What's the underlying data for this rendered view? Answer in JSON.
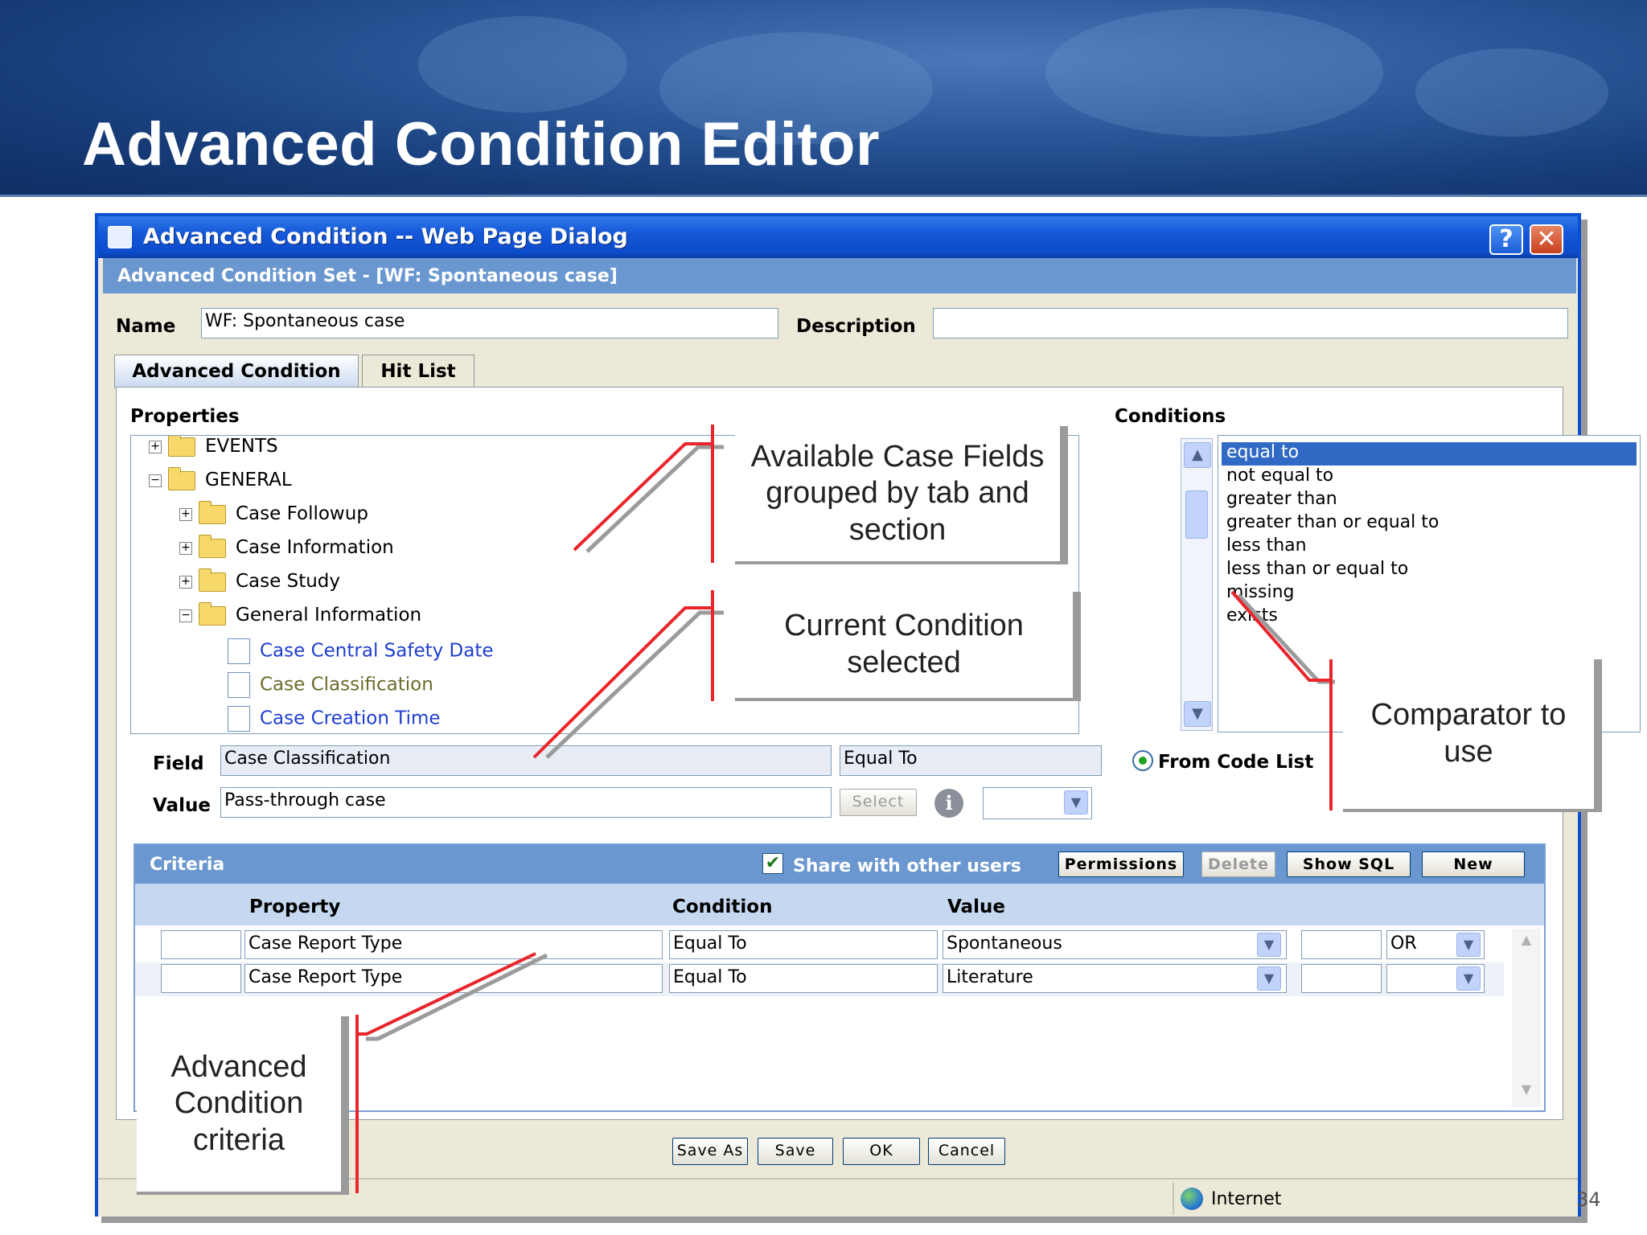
{
  "slide": {
    "title": "Advanced Condition Editor",
    "page_number": "34"
  },
  "window": {
    "title": "Advanced Condition -- Web Page Dialog",
    "help": "?",
    "close": "✕"
  },
  "set_header": "Advanced Condition Set - [WF: Spontaneous case]",
  "form": {
    "name_label": "Name",
    "name_value": "WF: Spontaneous case",
    "description_label": "Description",
    "description_value": ""
  },
  "tabs": [
    "Advanced Condition",
    "Hit List"
  ],
  "properties": {
    "label": "Properties",
    "tree": [
      {
        "label": "EVENTS",
        "expander": "+"
      },
      {
        "label": "GENERAL",
        "expander": "−"
      },
      {
        "label": "Case Followup",
        "expander": "+"
      },
      {
        "label": "Case Information",
        "expander": "+"
      },
      {
        "label": "Case Study",
        "expander": "+"
      },
      {
        "label": "General Information",
        "expander": "−"
      },
      {
        "label": "Case Central Safety Date"
      },
      {
        "label": "Case Classification"
      },
      {
        "label": "Case Creation Time"
      }
    ]
  },
  "conditions": {
    "label": "Conditions",
    "items": [
      "equal to",
      "not equal to",
      "greater than",
      "greater than or equal to",
      "less than",
      "less than or equal to",
      "missing",
      "exists"
    ],
    "selected": "equal to"
  },
  "field_row": {
    "field_label": "Field",
    "field_value": "Case Classification",
    "operator_value": "Equal To",
    "from_code_list_label": "From Code List"
  },
  "value_row": {
    "value_label": "Value",
    "value_value": "Pass-through case",
    "select_button": "Select",
    "info_icon": "i"
  },
  "criteria": {
    "title": "Criteria",
    "share_label": "Share with other users",
    "share_checked": true,
    "buttons": {
      "permissions": "Permissions",
      "delete": "Delete",
      "show_sql": "Show SQL",
      "new": "New"
    },
    "columns": {
      "property": "Property",
      "condition": "Condition",
      "value": "Value"
    },
    "rows": [
      {
        "property": "Case Report Type",
        "condition": "Equal To",
        "value": "Spontaneous",
        "logic": "OR"
      },
      {
        "property": "Case Report Type",
        "condition": "Equal To",
        "value": "Literature",
        "logic": ""
      }
    ]
  },
  "footer_buttons": {
    "save_as": "Save As",
    "save": "Save",
    "ok": "OK",
    "cancel": "Cancel"
  },
  "status": {
    "zone": "Internet"
  },
  "callouts": {
    "available_fields": "Available Case Fields grouped by tab and section",
    "current_condition": "Current Condition selected",
    "comparator": "Comparator to use",
    "criteria": "Advanced Condition criteria"
  },
  "colors": {
    "title_bar": "#0a4fd2",
    "section_header": "#6a97cf",
    "selection": "#316ac5",
    "callout_line": "#e8262c"
  }
}
